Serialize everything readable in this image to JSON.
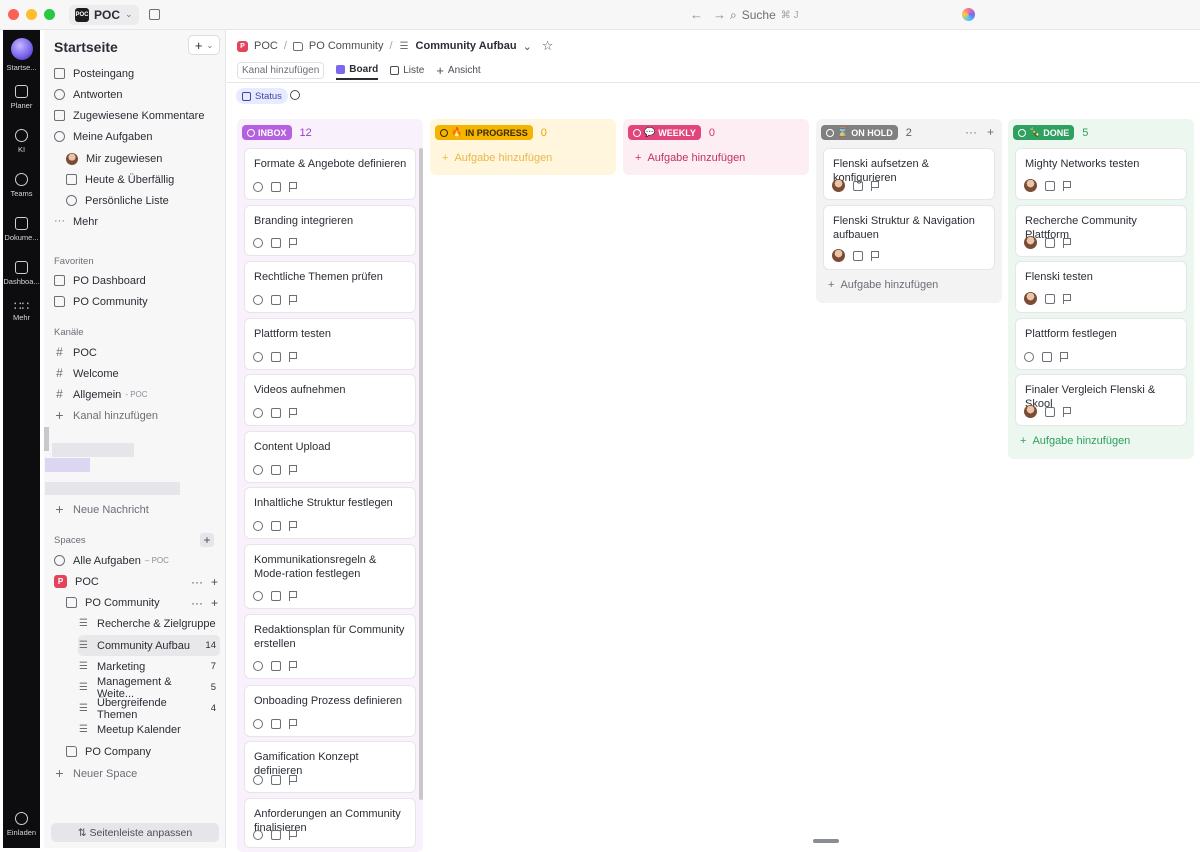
{
  "titlebar": {
    "workspace_logo": "POC",
    "workspace_name": "POC",
    "search_label": "Suche",
    "search_shortcut": "⌘ J"
  },
  "rail": {
    "items": [
      {
        "label": "Startse..."
      },
      {
        "label": "Planer"
      },
      {
        "label": "KI"
      },
      {
        "label": "Teams"
      },
      {
        "label": "Dokume..."
      },
      {
        "label": "Dashboa..."
      },
      {
        "label": "Mehr"
      }
    ],
    "invite_label": "Einladen"
  },
  "sidebar": {
    "title": "Startseite",
    "add_label": "+",
    "home_items": [
      {
        "label": "Posteingang"
      },
      {
        "label": "Antworten"
      },
      {
        "label": "Zugewiesene Kommentare"
      },
      {
        "label": "Meine Aufgaben"
      },
      {
        "label": "Mir zugewiesen"
      },
      {
        "label": "Heute & Überfällig"
      },
      {
        "label": "Persönliche Liste"
      },
      {
        "label": "Mehr"
      }
    ],
    "favorites_title": "Favoriten",
    "favorites": [
      {
        "label": "PO Dashboard"
      },
      {
        "label": "PO Community"
      }
    ],
    "channels_title": "Kanäle",
    "channels": [
      {
        "label": "POC"
      },
      {
        "label": "Welcome"
      },
      {
        "label": "Allgemein",
        "sub": "- POC"
      },
      {
        "label": "Kanal hinzufügen"
      }
    ],
    "new_message": "Neue Nachricht",
    "spaces_title": "Spaces",
    "all_tasks": {
      "label": "Alle Aufgaben",
      "sub": "– POC"
    },
    "space_badge": "P",
    "space": "POC",
    "folder": "PO Community",
    "lists": [
      {
        "label": "Recherche & Zielgruppe",
        "count": ""
      },
      {
        "label": "Community Aufbau",
        "count": "14"
      },
      {
        "label": "Marketing",
        "count": "7"
      },
      {
        "label": "Management & Weite...",
        "count": "5"
      },
      {
        "label": "Übergreifende Themen",
        "count": "4"
      },
      {
        "label": "Meetup Kalender",
        "count": ""
      }
    ],
    "company": "PO Company",
    "new_space": "Neuer Space",
    "customize": "⇅ Seitenleiste anpassen"
  },
  "header": {
    "crumb_badge": "P",
    "crumbs": [
      "POC",
      "PO Community",
      "Community Aufbau"
    ],
    "add_channel": "Kanal hinzufügen",
    "tab_board": "Board",
    "tab_list": "Liste",
    "tab_view": "Ansicht",
    "group_by": "Status"
  },
  "board": {
    "add_task_label": "Aufgabe hinzufügen",
    "columns": [
      {
        "name": "INBOX",
        "count": "12",
        "color": "#b660e0",
        "cards": [
          {
            "title": "Formate & Angebote definieren"
          },
          {
            "title": "Branding integrieren"
          },
          {
            "title": "Rechtliche Themen prüfen"
          },
          {
            "title": "Plattform testen"
          },
          {
            "title": "Videos aufnehmen"
          },
          {
            "title": "Content Upload"
          },
          {
            "title": "Inhaltliche Struktur festlegen"
          },
          {
            "title": "Kommunikationsregeln & Mode-ration festlegen"
          },
          {
            "title": "Redaktionsplan für Community erstellen"
          },
          {
            "title": "Onboading Prozess definieren"
          },
          {
            "title": "Gamification Konzept definieren"
          },
          {
            "title": "Anforderungen an Community finalisieren"
          }
        ]
      },
      {
        "name": "IN PROGRESS",
        "count": "0",
        "color": "#f5b400",
        "cards": []
      },
      {
        "name": "WEEKLY",
        "count": "0",
        "color": "#e0457b",
        "cards": []
      },
      {
        "name": "ON HOLD",
        "count": "2",
        "color": "#808080",
        "cards": [
          {
            "title": "Flenski aufsetzen & konfigurieren"
          },
          {
            "title": "Flenski Struktur & Navigation aufbauen"
          }
        ]
      },
      {
        "name": "DONE",
        "count": "5",
        "color": "#2ea05f",
        "cards": [
          {
            "title": "Mighty Networks testen"
          },
          {
            "title": "Recherche Community Plattform"
          },
          {
            "title": "Flenski testen"
          },
          {
            "title": "Plattform festlegen"
          },
          {
            "title": "Finaler Vergleich Flenski & Skool"
          }
        ]
      }
    ]
  },
  "colors": {
    "accent": "#7b68ee",
    "inbox_bg": "#f9f1fb",
    "progress_bg": "#fff6dd",
    "weekly_bg": "#fdeef3",
    "hold_bg": "#f3f3f4",
    "done_bg": "#ebf7ef"
  }
}
